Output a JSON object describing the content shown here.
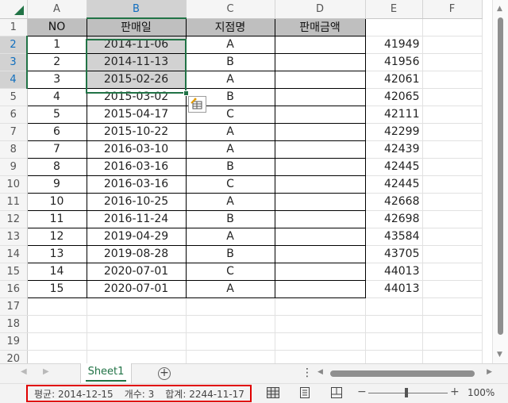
{
  "columns": [
    "A",
    "B",
    "C",
    "D",
    "E",
    "F"
  ],
  "row_numbers": [
    "1",
    "2",
    "3",
    "4",
    "5",
    "6",
    "7",
    "8",
    "9",
    "10",
    "11",
    "12",
    "13",
    "14",
    "15",
    "16",
    "17",
    "18",
    "19",
    "20"
  ],
  "table": {
    "headers": [
      "NO",
      "판매일",
      "지점명",
      "판매금액"
    ],
    "rows": [
      {
        "no": "1",
        "date": "2014-11-06",
        "branch": "A",
        "amount": "",
        "serial": "41949"
      },
      {
        "no": "2",
        "date": "2014-11-13",
        "branch": "B",
        "amount": "",
        "serial": "41956"
      },
      {
        "no": "3",
        "date": "2015-02-26",
        "branch": "A",
        "amount": "",
        "serial": "42061"
      },
      {
        "no": "4",
        "date": "2015-03-02",
        "branch": "B",
        "amount": "",
        "serial": "42065"
      },
      {
        "no": "5",
        "date": "2015-04-17",
        "branch": "C",
        "amount": "",
        "serial": "42111"
      },
      {
        "no": "6",
        "date": "2015-10-22",
        "branch": "A",
        "amount": "",
        "serial": "42299"
      },
      {
        "no": "7",
        "date": "2016-03-10",
        "branch": "A",
        "amount": "",
        "serial": "42439"
      },
      {
        "no": "8",
        "date": "2016-03-16",
        "branch": "B",
        "amount": "",
        "serial": "42445"
      },
      {
        "no": "9",
        "date": "2016-03-16",
        "branch": "C",
        "amount": "",
        "serial": "42445"
      },
      {
        "no": "10",
        "date": "2016-10-25",
        "branch": "A",
        "amount": "",
        "serial": "42668"
      },
      {
        "no": "11",
        "date": "2016-11-24",
        "branch": "B",
        "amount": "",
        "serial": "42698"
      },
      {
        "no": "12",
        "date": "2019-04-29",
        "branch": "A",
        "amount": "",
        "serial": "43584"
      },
      {
        "no": "13",
        "date": "2019-08-28",
        "branch": "B",
        "amount": "",
        "serial": "43705"
      },
      {
        "no": "14",
        "date": "2020-07-01",
        "branch": "C",
        "amount": "",
        "serial": "44013"
      },
      {
        "no": "15",
        "date": "2020-07-01",
        "branch": "A",
        "amount": "",
        "serial": "44013"
      }
    ]
  },
  "sheet_tab": "Sheet1",
  "status": {
    "average": "평균: 2014-12-15",
    "count": "개수: 3",
    "sum": "합계: 2244-11-17"
  },
  "zoom_level": "100%",
  "colors": {
    "accent": "#217346",
    "header_fill": "#bfbfbf",
    "selection_fill": "#d2d2d2",
    "highlight_box": "#e00000"
  },
  "icons": [
    "quick-analysis-icon",
    "add-sheet-icon",
    "normal-view-icon",
    "page-layout-view-icon",
    "page-break-view-icon"
  ]
}
